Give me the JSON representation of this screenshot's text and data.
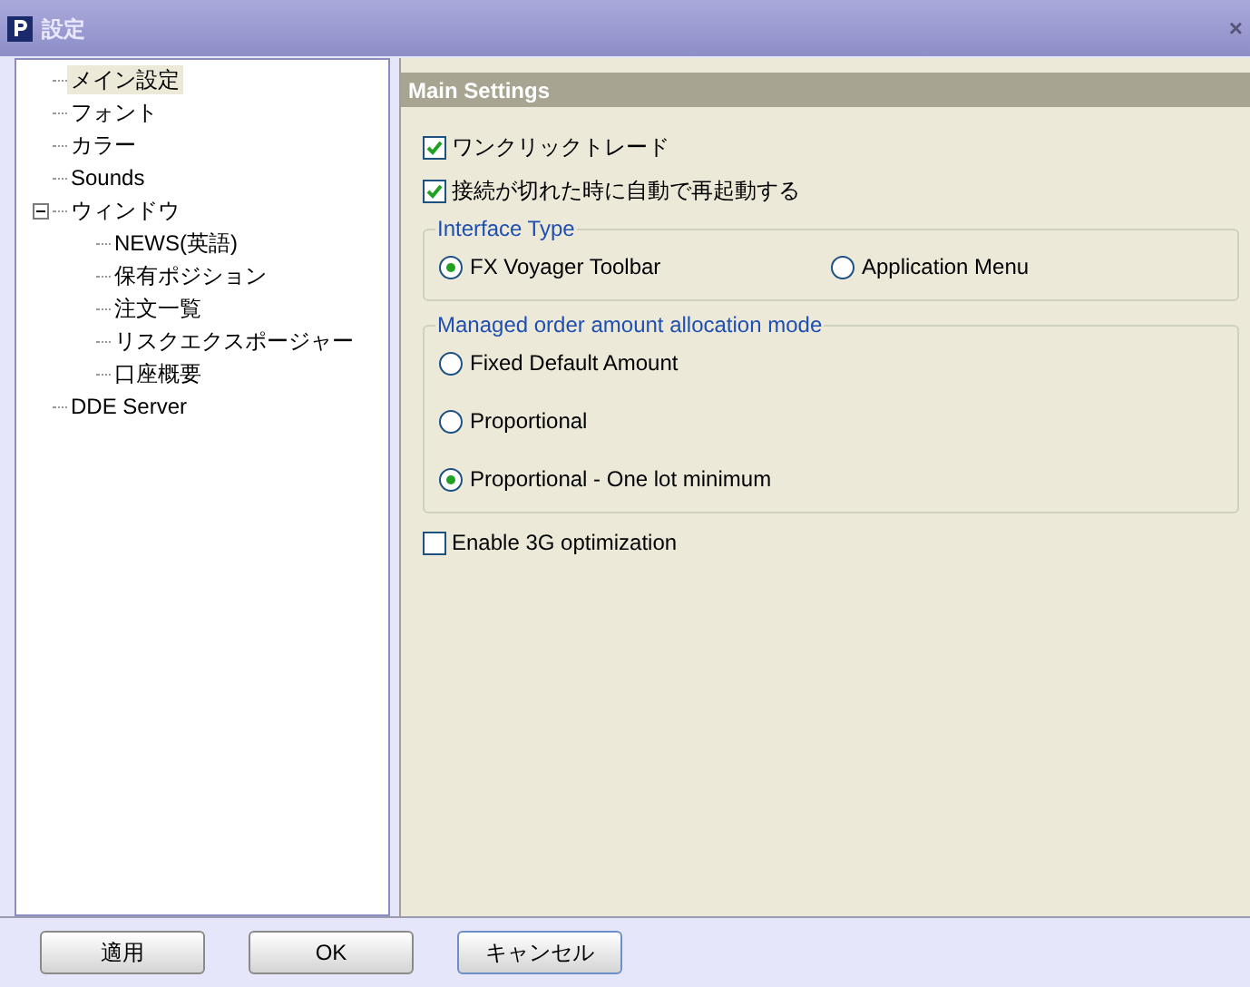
{
  "window": {
    "title": "設定",
    "close": "×"
  },
  "tree": [
    {
      "label": "メイン設定",
      "selected": true
    },
    {
      "label": "フォント",
      "selected": false
    },
    {
      "label": "カラー",
      "selected": false
    },
    {
      "label": "Sounds",
      "selected": false
    },
    {
      "label": "ウィンドウ",
      "selected": false,
      "expanded": true,
      "children": [
        {
          "label": "NEWS(英語)",
          "selected": false
        },
        {
          "label": "保有ポジション",
          "selected": false
        },
        {
          "label": "注文一覧",
          "selected": false
        },
        {
          "label": "リスクエクスポージャー",
          "selected": false
        },
        {
          "label": "口座概要",
          "selected": false
        }
      ]
    },
    {
      "label": "DDE Server",
      "selected": false
    }
  ],
  "panel": {
    "title": "Main Settings",
    "items": [
      {
        "kind": "checkbox",
        "label": "ワンクリックトレード",
        "checked": true
      },
      {
        "kind": "checkbox",
        "label": "接続が切れた時に自動で再起動する",
        "checked": true
      },
      {
        "kind": "group",
        "title": "Interface Type",
        "horizontal": true,
        "options": [
          {
            "label": "FX Voyager Toolbar",
            "selected": true
          },
          {
            "label": "Application Menu",
            "selected": false
          }
        ]
      },
      {
        "kind": "group",
        "title": "Managed order amount allocation mode",
        "horizontal": false,
        "options": [
          {
            "label": "Fixed Default Amount",
            "selected": false
          },
          {
            "label": "Proportional",
            "selected": false
          },
          {
            "label": "Proportional - One lot minimum",
            "selected": true
          }
        ]
      },
      {
        "kind": "checkbox",
        "label": "Enable 3G optimization",
        "checked": false
      }
    ]
  },
  "buttons": [
    {
      "label": "適用",
      "focused": false
    },
    {
      "label": "OK",
      "focused": false
    },
    {
      "label": "キャンセル",
      "focused": true
    }
  ]
}
